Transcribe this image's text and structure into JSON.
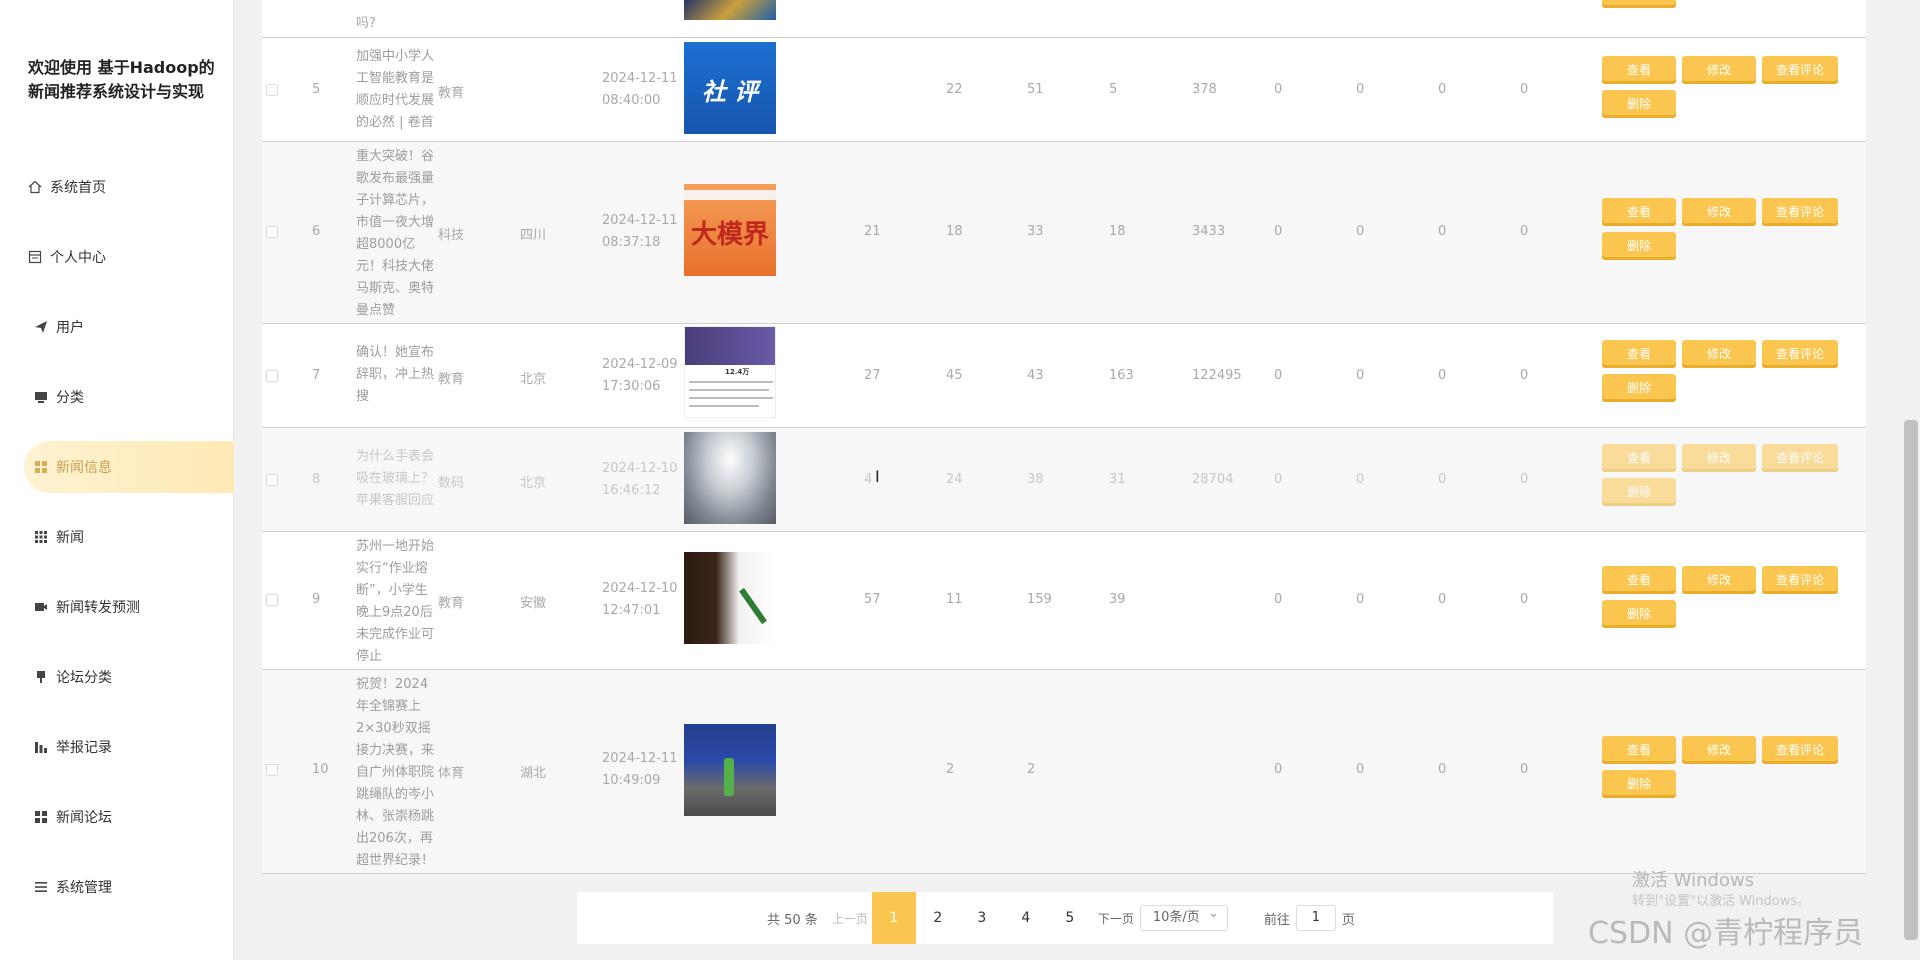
{
  "app": {
    "title": "欢迎使用 基于Hadoop的新闻推荐系统设计与实现"
  },
  "sidebar": {
    "items": [
      {
        "label": "系统首页",
        "icon": "home-icon"
      },
      {
        "label": "个人中心",
        "icon": "profile-icon"
      },
      {
        "label": "用户",
        "icon": "send-icon"
      },
      {
        "label": "分类",
        "icon": "monitor-icon"
      },
      {
        "label": "新闻信息",
        "icon": "grid-icon",
        "active": true
      },
      {
        "label": "新闻",
        "icon": "apps-icon"
      },
      {
        "label": "新闻转发预测",
        "icon": "film-icon"
      },
      {
        "label": "论坛分类",
        "icon": "pin-icon"
      },
      {
        "label": "举报记录",
        "icon": "bar-icon"
      },
      {
        "label": "新闻论坛",
        "icon": "grid-icon"
      },
      {
        "label": "系统管理",
        "icon": "list-icon"
      }
    ]
  },
  "table": {
    "top_partial": "吗?",
    "rows": [
      {
        "no": "5",
        "title": "加强中小学人工智能教育是顺应时代发展的必然 | 卷首",
        "category": "教育",
        "region": "",
        "date": "2024-12-11",
        "time": "08:40:00",
        "thumb_text": "社 评",
        "c1": "",
        "c2": "22",
        "c3": "51",
        "c4": "5",
        "c5": "378",
        "c6": "0",
        "c7": "0",
        "c8": "0",
        "c9": "0"
      },
      {
        "no": "6",
        "title": "重大突破！谷歌发布最强量子计算芯片，市值一夜大增超8000亿元！科技大佬马斯克、奥特曼点赞",
        "category": "科技",
        "region": "四川",
        "date": "2024-12-11",
        "time": "08:37:18",
        "thumb_text": "大模界",
        "c1": "21",
        "c2": "18",
        "c3": "33",
        "c4": "18",
        "c5": "3433",
        "c6": "0",
        "c7": "0",
        "c8": "0",
        "c9": "0"
      },
      {
        "no": "7",
        "title": "确认！她宣布辞职，冲上热搜",
        "category": "教育",
        "region": "北京",
        "date": "2024-12-09",
        "time": "17:30:06",
        "thumb_text": "12.4万",
        "c1": "27",
        "c2": "45",
        "c3": "43",
        "c4": "163",
        "c5": "122495",
        "c6": "0",
        "c7": "0",
        "c8": "0",
        "c9": "0"
      },
      {
        "no": "8",
        "title": "为什么手表会吸在玻璃上？苹果客服回应",
        "category": "数码",
        "region": "北京",
        "date": "2024-12-10",
        "time": "16:46:12",
        "thumb_text": "",
        "c1": "4",
        "c2": "24",
        "c3": "38",
        "c4": "31",
        "c5": "28704",
        "c6": "0",
        "c7": "0",
        "c8": "0",
        "c9": "0"
      },
      {
        "no": "9",
        "title": "苏州一地开始实行“作业熔断”，小学生晚上9点20后未完成作业可停止",
        "category": "教育",
        "region": "安徽",
        "date": "2024-12-10",
        "time": "12:47:01",
        "thumb_text": "",
        "c1": "57",
        "c2": "11",
        "c3": "159",
        "c4": "39",
        "c5": "",
        "c6": "0",
        "c7": "0",
        "c8": "0",
        "c9": "0"
      },
      {
        "no": "10",
        "title": "祝贺！2024年全锦赛上2×30秒双摇接力决赛，来自广州体职院跳绳队的岑小林、张崇杨跳出206次，再超世界纪录！",
        "category": "体育",
        "region": "湖北",
        "date": "2024-12-11",
        "time": "10:49:09",
        "thumb_text": "",
        "c1": "",
        "c2": "2",
        "c3": "2",
        "c4": "",
        "c5": "",
        "c6": "0",
        "c7": "0",
        "c8": "0",
        "c9": "0"
      }
    ],
    "actions": {
      "view": "查看",
      "edit": "修改",
      "comments": "查看评论",
      "delete": "删除"
    }
  },
  "pagination": {
    "total": "共 50 条",
    "prev": "上一页",
    "pages": [
      "1",
      "2",
      "3",
      "4",
      "5"
    ],
    "next": "下一页",
    "page_size": "10条/页",
    "goto_label": "前往",
    "goto_value": "1",
    "goto_unit": "页"
  },
  "watermark": {
    "line1": "激活 Windows",
    "line2": "转到\"设置\"以激活 Windows。",
    "csdn": "CSDN @青柠程序员"
  },
  "colors": {
    "accent": "#fbc64f",
    "active_bg": "#fff0cc"
  }
}
